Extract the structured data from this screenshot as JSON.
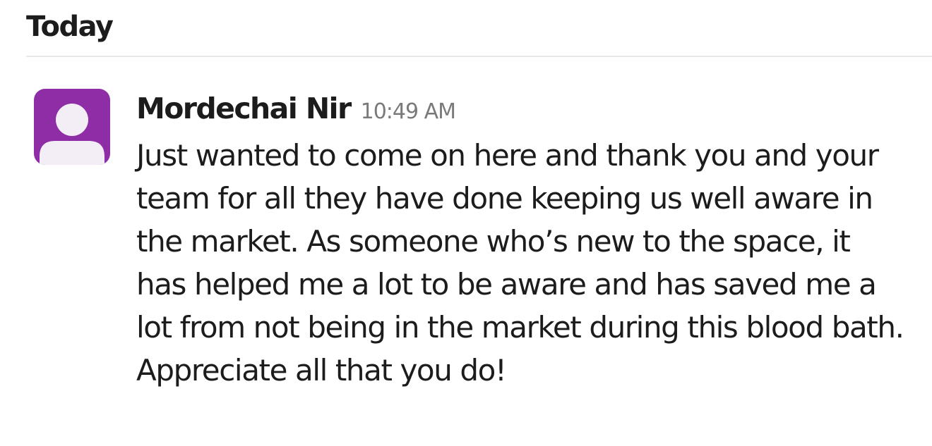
{
  "day_header": {
    "label": "Today"
  },
  "message": {
    "sender": "Mordechai Nir",
    "timestamp": "10:49 AM",
    "text": "Just wanted to come on here and thank you and your team for all they have done keeping us well aware in the market. As someone who’s new to the space, it has helped me a lot to be aware and has saved me a lot from not being in the market during this blood bath. Appreciate all that you do!",
    "avatar": {
      "icon": "default-user-icon",
      "background_color": "#8e2da6",
      "figure_color": "#f3eef5"
    }
  }
}
